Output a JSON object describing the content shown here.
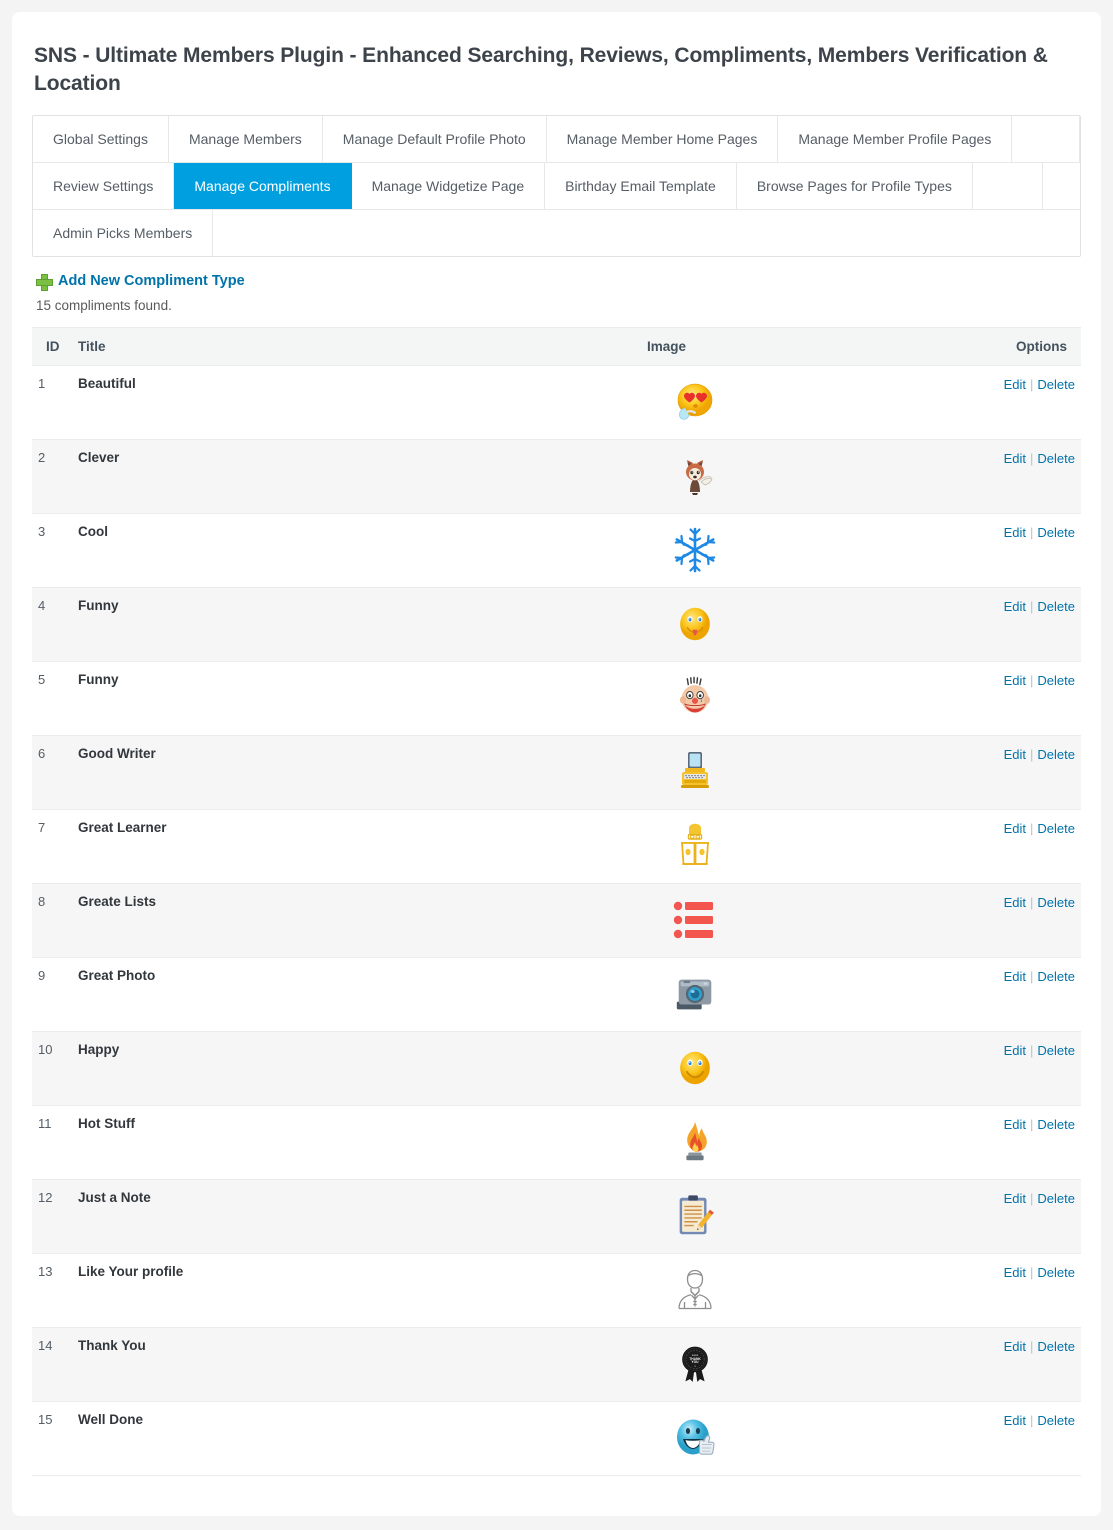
{
  "page": {
    "title": "SNS - Ultimate Members Plugin - Enhanced Searching, Reviews, Compliments, Members Verification & Location"
  },
  "tabs": {
    "rows": [
      [
        {
          "label": "Global Settings",
          "active": false
        },
        {
          "label": "Manage Members",
          "active": false
        },
        {
          "label": "Manage Default Profile Photo",
          "active": false
        },
        {
          "label": "Manage Member Home Pages",
          "active": false
        },
        {
          "label": "Manage Member Profile Pages",
          "active": false
        }
      ],
      [
        {
          "label": "Review Settings",
          "active": false
        },
        {
          "label": "Manage Compliments",
          "active": true
        },
        {
          "label": "Manage Widgetize Page",
          "active": false
        },
        {
          "label": "Birthday Email Template",
          "active": false
        },
        {
          "label": "Browse Pages for Profile Types",
          "active": false
        }
      ],
      [
        {
          "label": "Admin Picks Members",
          "active": false
        }
      ]
    ]
  },
  "toolbar": {
    "add_label": "Add New Compliment Type",
    "add_icon": "plus-icon",
    "count_text": "15 compliments found."
  },
  "table": {
    "headers": {
      "id": "ID",
      "title": "Title",
      "image": "Image",
      "options": "Options"
    },
    "actions": {
      "edit": "Edit",
      "separator": "|",
      "delete": "Delete"
    },
    "rows": [
      {
        "id": "1",
        "title": "Beautiful",
        "icon": "heart-eyes-smiley-icon"
      },
      {
        "id": "2",
        "title": "Clever",
        "icon": "fox-icon"
      },
      {
        "id": "3",
        "title": "Cool",
        "icon": "snowflake-icon"
      },
      {
        "id": "4",
        "title": "Funny",
        "icon": "tongue-out-smiley-icon"
      },
      {
        "id": "5",
        "title": "Funny",
        "icon": "clown-face-icon"
      },
      {
        "id": "6",
        "title": "Good Writer",
        "icon": "typewriter-icon"
      },
      {
        "id": "7",
        "title": "Great Learner",
        "icon": "person-reading-book-icon"
      },
      {
        "id": "8",
        "title": "Greate Lists",
        "icon": "bullet-list-icon"
      },
      {
        "id": "9",
        "title": "Great Photo",
        "icon": "camera-icon"
      },
      {
        "id": "10",
        "title": "Happy",
        "icon": "smiley-face-icon"
      },
      {
        "id": "11",
        "title": "Hot Stuff",
        "icon": "fire-flame-icon"
      },
      {
        "id": "12",
        "title": "Just a Note",
        "icon": "clipboard-pencil-icon"
      },
      {
        "id": "13",
        "title": "Like Your profile",
        "icon": "avatar-person-icon"
      },
      {
        "id": "14",
        "title": "Thank You",
        "icon": "award-ribbon-icon"
      },
      {
        "id": "15",
        "title": "Well Done",
        "icon": "thumbs-up-smiley-icon"
      }
    ]
  },
  "colors": {
    "active_tab": "#00a0e0",
    "link": "#0073aa",
    "plus_green": "#7ac143",
    "row_alt": "#f6f6f6",
    "header_bg": "#f4f5f5"
  }
}
